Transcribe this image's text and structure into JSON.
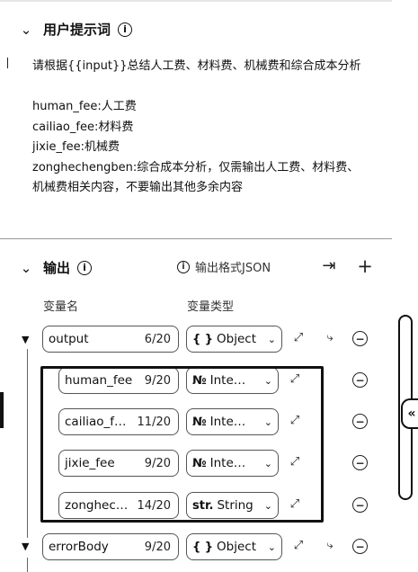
{
  "user_prompt": {
    "title": "用户提示词",
    "info_symbol": "i",
    "content": "请根据{{input}}总结人工费、材料费、机械费和综合成本分析\n\nhuman_fee:人工费\ncailiao_fee:材料费\njixie_fee:机械费\nzonghechengben:综合成本分析，仅需输出人工费、材料费、机械费相关内容，不要输出其他多余内容"
  },
  "output": {
    "title": "输出",
    "info_symbol": "i",
    "format_hint": "输出格式JSON",
    "col_name_label": "变量名",
    "col_type_label": "变量类型",
    "rows": [
      {
        "name": "output",
        "count": "6/20",
        "type_icon": "{ }",
        "type": "Object"
      },
      {
        "name": "human_fee",
        "count": "9/20",
        "type_icon": "№",
        "type": "Inte…"
      },
      {
        "name": "cailiao_f…",
        "count": "11/20",
        "type_icon": "№",
        "type": "Inte…"
      },
      {
        "name": "jixie_fee",
        "count": "9/20",
        "type_icon": "№",
        "type": "Inte…"
      },
      {
        "name": "zonghec…",
        "count": "14/20",
        "type_icon": "str.",
        "type": "String"
      },
      {
        "name": "errorBody",
        "count": "9/20",
        "type_icon": "{ }",
        "type": "Object"
      }
    ]
  },
  "icons": {
    "chevron": "⌄",
    "tree_expand": "▼",
    "dropdown": "⌄",
    "expand": "⤢",
    "add_child": "⤷",
    "remove": "−",
    "export": "⇥",
    "add": "+",
    "collapse_panel": "«"
  }
}
